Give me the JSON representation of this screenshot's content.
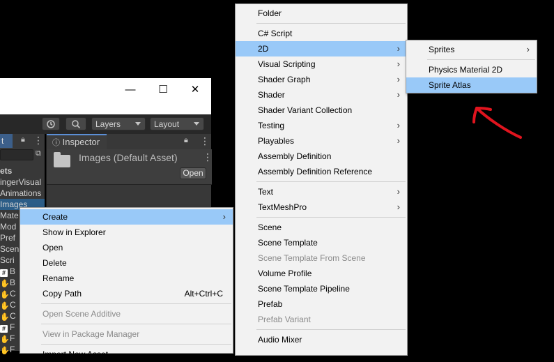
{
  "toolbar": {
    "history_icon": "history-icon",
    "search_icon": "search-icon",
    "layers_label": "Layers",
    "layout_label": "Layout"
  },
  "window_controls": {
    "minimize": "—",
    "maximize": "☐",
    "close": "✕"
  },
  "project": {
    "tab_label": "t",
    "tree_header": "ets",
    "items": [
      {
        "label": "ingerVisual",
        "icon": ""
      },
      {
        "label": "Animations",
        "icon": ""
      },
      {
        "label": "Images",
        "icon": "",
        "selected": true
      },
      {
        "label": "Mate",
        "icon": ""
      },
      {
        "label": "Mod",
        "icon": ""
      },
      {
        "label": "Pref",
        "icon": ""
      },
      {
        "label": "Scen",
        "icon": ""
      },
      {
        "label": "Scri",
        "icon": ""
      },
      {
        "label": "B",
        "icon": "#"
      },
      {
        "label": "B",
        "icon": "✋"
      },
      {
        "label": "C",
        "icon": "✋"
      },
      {
        "label": "C",
        "icon": "✋"
      },
      {
        "label": "C",
        "icon": "✋"
      },
      {
        "label": "F",
        "icon": "#"
      },
      {
        "label": "F",
        "icon": "✋"
      },
      {
        "label": "F",
        "icon": "✋"
      }
    ]
  },
  "inspector": {
    "tab_label": "Inspector",
    "title": "Images (Default Asset)",
    "open_label": "Open"
  },
  "menu1": {
    "items": [
      {
        "label": "Create",
        "submenu": true,
        "highlighted": true
      },
      {
        "label": "Show in Explorer"
      },
      {
        "label": "Open"
      },
      {
        "label": "Delete"
      },
      {
        "label": "Rename"
      },
      {
        "label": "Copy Path",
        "shortcut": "Alt+Ctrl+C"
      },
      {
        "label": "Open Scene Additive",
        "disabled": true
      },
      {
        "label": "View in Package Manager",
        "disabled": true
      },
      {
        "label": "Import New Asset..."
      }
    ]
  },
  "menu2": {
    "items": [
      {
        "label": "Folder"
      },
      {
        "label": "C# Script"
      },
      {
        "label": "2D",
        "submenu": true,
        "highlighted": true
      },
      {
        "label": "Visual Scripting",
        "submenu": true
      },
      {
        "label": "Shader Graph",
        "submenu": true
      },
      {
        "label": "Shader",
        "submenu": true
      },
      {
        "label": "Shader Variant Collection"
      },
      {
        "label": "Testing",
        "submenu": true
      },
      {
        "label": "Playables",
        "submenu": true
      },
      {
        "label": "Assembly Definition"
      },
      {
        "label": "Assembly Definition Reference"
      },
      {
        "label": "Text",
        "submenu": true
      },
      {
        "label": "TextMeshPro",
        "submenu": true
      },
      {
        "label": "Scene"
      },
      {
        "label": "Scene Template"
      },
      {
        "label": "Scene Template From Scene",
        "disabled": true
      },
      {
        "label": "Volume Profile"
      },
      {
        "label": "Scene Template Pipeline"
      },
      {
        "label": "Prefab"
      },
      {
        "label": "Prefab Variant",
        "disabled": true
      },
      {
        "label": "Audio Mixer"
      }
    ]
  },
  "menu3": {
    "items": [
      {
        "label": "Sprites",
        "submenu": true
      },
      {
        "label": "Physics Material 2D"
      },
      {
        "label": "Sprite Atlas",
        "highlighted": true
      }
    ]
  },
  "colors": {
    "menu_bg": "#f2f2f2",
    "menu_highlight": "#99c9f8",
    "annotation_arrow": "#e0141e",
    "editor_dark": "#383838",
    "selection_blue": "#2c5d87"
  }
}
